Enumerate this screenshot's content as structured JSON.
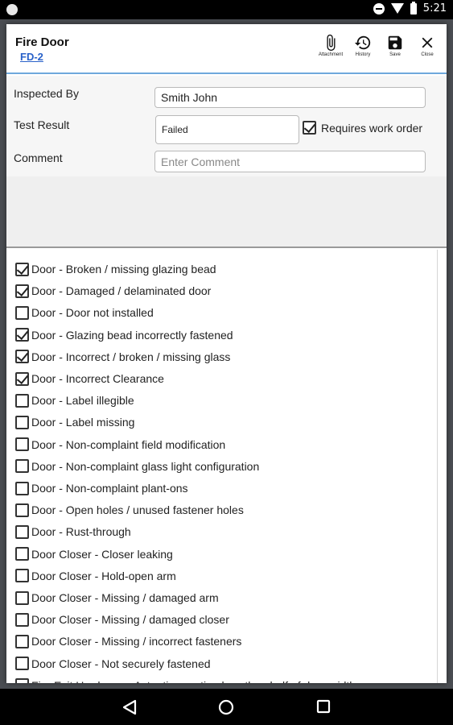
{
  "status_bar": {
    "time": "5:21"
  },
  "header": {
    "title": "Fire Door",
    "subtitle": "FD-2",
    "toolbar": [
      {
        "label": "Attachment",
        "icon": "paperclip-icon"
      },
      {
        "label": "History",
        "icon": "history-icon"
      },
      {
        "label": "Save",
        "icon": "save-icon"
      },
      {
        "label": "Close",
        "icon": "close-icon"
      }
    ]
  },
  "form": {
    "inspected_by_label": "Inspected By",
    "inspected_by_value": "Smith John",
    "test_result_label": "Test Result",
    "test_result_value": "Failed",
    "requires_work_order_label": "Requires work order",
    "requires_work_order_checked": true,
    "comment_label": "Comment",
    "comment_placeholder": "Enter Comment"
  },
  "deficiencies": [
    {
      "label": "Door - Broken / missing glazing bead",
      "checked": true
    },
    {
      "label": "Door - Damaged / delaminated door",
      "checked": true
    },
    {
      "label": "Door - Door not installed",
      "checked": false
    },
    {
      "label": "Door - Glazing bead incorrectly fastened",
      "checked": true
    },
    {
      "label": "Door - Incorrect / broken / missing glass",
      "checked": true
    },
    {
      "label": "Door - Incorrect Clearance",
      "checked": true
    },
    {
      "label": "Door - Label illegible",
      "checked": false
    },
    {
      "label": "Door - Label missing",
      "checked": false
    },
    {
      "label": "Door - Non-complaint field modification",
      "checked": false
    },
    {
      "label": "Door - Non-complaint glass light configuration",
      "checked": false
    },
    {
      "label": "Door - Non-complaint plant-ons",
      "checked": false
    },
    {
      "label": "Door - Open holes / unused fastener holes",
      "checked": false
    },
    {
      "label": "Door - Rust-through",
      "checked": false
    },
    {
      "label": "Door Closer - Closer leaking",
      "checked": false
    },
    {
      "label": "Door Closer - Hold-open arm",
      "checked": false
    },
    {
      "label": "Door Closer - Missing / damaged arm",
      "checked": false
    },
    {
      "label": "Door Closer - Missing / damaged closer",
      "checked": false
    },
    {
      "label": "Door Closer - Missing / incorrect fasteners",
      "checked": false
    },
    {
      "label": "Door Closer - Not securely fastened",
      "checked": false
    },
    {
      "label": "Fire Exit Hardware - Actuating portion less than half of door width",
      "checked": false
    }
  ],
  "colors": {
    "accent": "#6fa8dc",
    "link": "#2a62c9"
  }
}
